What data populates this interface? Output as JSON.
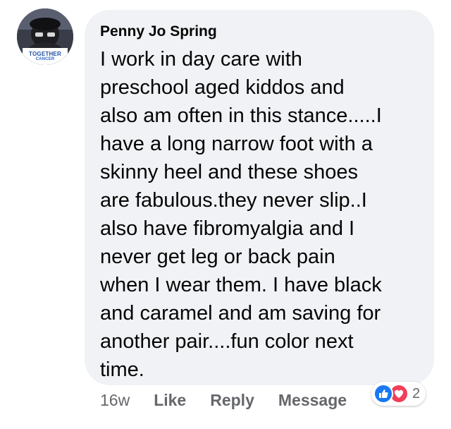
{
  "comment": {
    "author": "Penny Jo Spring",
    "text": "I work in day care with\npreschool aged kiddos and\nalso am often in this stance.....I\nhave a long narrow foot with a\nskinny heel and these shoes\nare fabulous.they never slip..I\nalso have fibromyalgia and I\nnever get leg or back pain\nwhen I wear them.  I have black\nand caramel and am saving for\nanother pair....fun color next\ntime."
  },
  "avatar": {
    "badge_line1": "TOGETHER",
    "badge_line2": "CANCER"
  },
  "actions": {
    "time": "16w",
    "like_label": "Like",
    "reply_label": "Reply",
    "message_label": "Message"
  },
  "reactions": {
    "count": "2",
    "icons": [
      "like-icon",
      "love-icon"
    ],
    "like_color": "#1877f2",
    "love_color": "#f33e58"
  },
  "colors": {
    "bubble": "#f0f2f5",
    "text": "#050505",
    "secondary_text": "#65676b"
  }
}
